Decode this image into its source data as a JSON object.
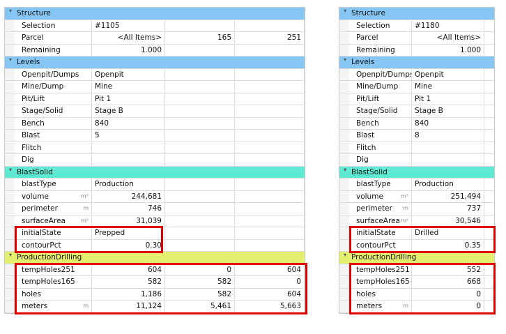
{
  "panels": [
    {
      "sections": [
        {
          "title": "Structure",
          "rows": [
            {
              "label": "Selection",
              "values": [
                "#1105",
                "",
                ""
              ]
            },
            {
              "label": "Parcel",
              "values": [
                "<All Items>",
                "165",
                "251"
              ]
            },
            {
              "label": "Remaining",
              "values": [
                "1.000",
                "",
                ""
              ]
            }
          ]
        },
        {
          "title": "Levels",
          "rows": [
            {
              "label": "Openpit/Dumps",
              "values": [
                "Openpit",
                "",
                ""
              ]
            },
            {
              "label": "Mine/Dump",
              "values": [
                "Mine",
                "",
                ""
              ]
            },
            {
              "label": "Pit/Lift",
              "values": [
                "Pit 1",
                "",
                ""
              ]
            },
            {
              "label": "Stage/Solid",
              "values": [
                "Stage B",
                "",
                ""
              ]
            },
            {
              "label": "Bench",
              "values": [
                "840",
                "",
                ""
              ]
            },
            {
              "label": "Blast",
              "values": [
                "5",
                "",
                ""
              ]
            },
            {
              "label": "Flitch",
              "values": [
                "",
                "",
                ""
              ]
            },
            {
              "label": "Dig",
              "values": [
                "",
                "",
                ""
              ]
            }
          ]
        },
        {
          "title": "BlastSolid",
          "rows": [
            {
              "label": "blastType",
              "values": [
                "Production",
                "",
                ""
              ]
            },
            {
              "label": "volume",
              "unit": "m³",
              "values": [
                "244,681",
                "",
                ""
              ]
            },
            {
              "label": "perimeter",
              "unit": "m",
              "values": [
                "746",
                "",
                ""
              ]
            },
            {
              "label": "surfaceArea",
              "unit": "m²",
              "values": [
                "31,039",
                "",
                ""
              ]
            },
            {
              "label": "initialState",
              "values": [
                "Prepped",
                "",
                ""
              ]
            },
            {
              "label": "contourPct",
              "values": [
                "0.30",
                "",
                ""
              ]
            }
          ]
        },
        {
          "title": "ProductionDrilling",
          "rows": [
            {
              "label": "tempHoles251",
              "values": [
                "604",
                "0",
                "604"
              ]
            },
            {
              "label": "tempHoles165",
              "values": [
                "582",
                "582",
                "0"
              ]
            },
            {
              "label": "holes",
              "values": [
                "1,186",
                "582",
                "604"
              ]
            },
            {
              "label": "meters",
              "unit": "m",
              "values": [
                "11,124",
                "5,461",
                "5,663"
              ]
            }
          ]
        }
      ]
    },
    {
      "sections": [
        {
          "title": "Structure",
          "rows": [
            {
              "label": "Selection",
              "values": [
                "#1180"
              ]
            },
            {
              "label": "Parcel",
              "values": [
                "<All Items>"
              ]
            },
            {
              "label": "Remaining",
              "values": [
                "1.000"
              ]
            }
          ]
        },
        {
          "title": "Levels",
          "rows": [
            {
              "label": "Openpit/Dumps",
              "values": [
                "Openpit"
              ]
            },
            {
              "label": "Mine/Dump",
              "values": [
                "Mine"
              ]
            },
            {
              "label": "Pit/Lift",
              "values": [
                "Pit 1"
              ]
            },
            {
              "label": "Stage/Solid",
              "values": [
                "Stage B"
              ]
            },
            {
              "label": "Bench",
              "values": [
                "840"
              ]
            },
            {
              "label": "Blast",
              "values": [
                "8"
              ]
            },
            {
              "label": "Flitch",
              "values": [
                ""
              ]
            },
            {
              "label": "Dig",
              "values": [
                ""
              ]
            }
          ]
        },
        {
          "title": "BlastSolid",
          "rows": [
            {
              "label": "blastType",
              "values": [
                "Production"
              ]
            },
            {
              "label": "volume",
              "unit": "m³",
              "values": [
                "251,494"
              ]
            },
            {
              "label": "perimeter",
              "unit": "m",
              "values": [
                "737"
              ]
            },
            {
              "label": "surfaceArea",
              "unit": "m²",
              "values": [
                "30,546"
              ]
            },
            {
              "label": "initialState",
              "values": [
                "Drilled"
              ]
            },
            {
              "label": "contourPct",
              "values": [
                "0.35"
              ]
            }
          ]
        },
        {
          "title": "ProductionDrilling",
          "rows": [
            {
              "label": "tempHoles251",
              "values": [
                "552"
              ]
            },
            {
              "label": "tempHoles165",
              "values": [
                "668"
              ]
            },
            {
              "label": "holes",
              "values": [
                "0"
              ]
            },
            {
              "label": "meters",
              "unit": "m",
              "values": [
                "0"
              ]
            }
          ]
        }
      ]
    }
  ],
  "colors": {
    "structure": "#86c6f4",
    "levels": "#86c6f4",
    "blastsolid": "#5fe8d2",
    "productiondrilling": "#e4ef6d",
    "highlight": "#e00000"
  },
  "icons": {
    "section_toggle": "chevron-down-icon"
  }
}
